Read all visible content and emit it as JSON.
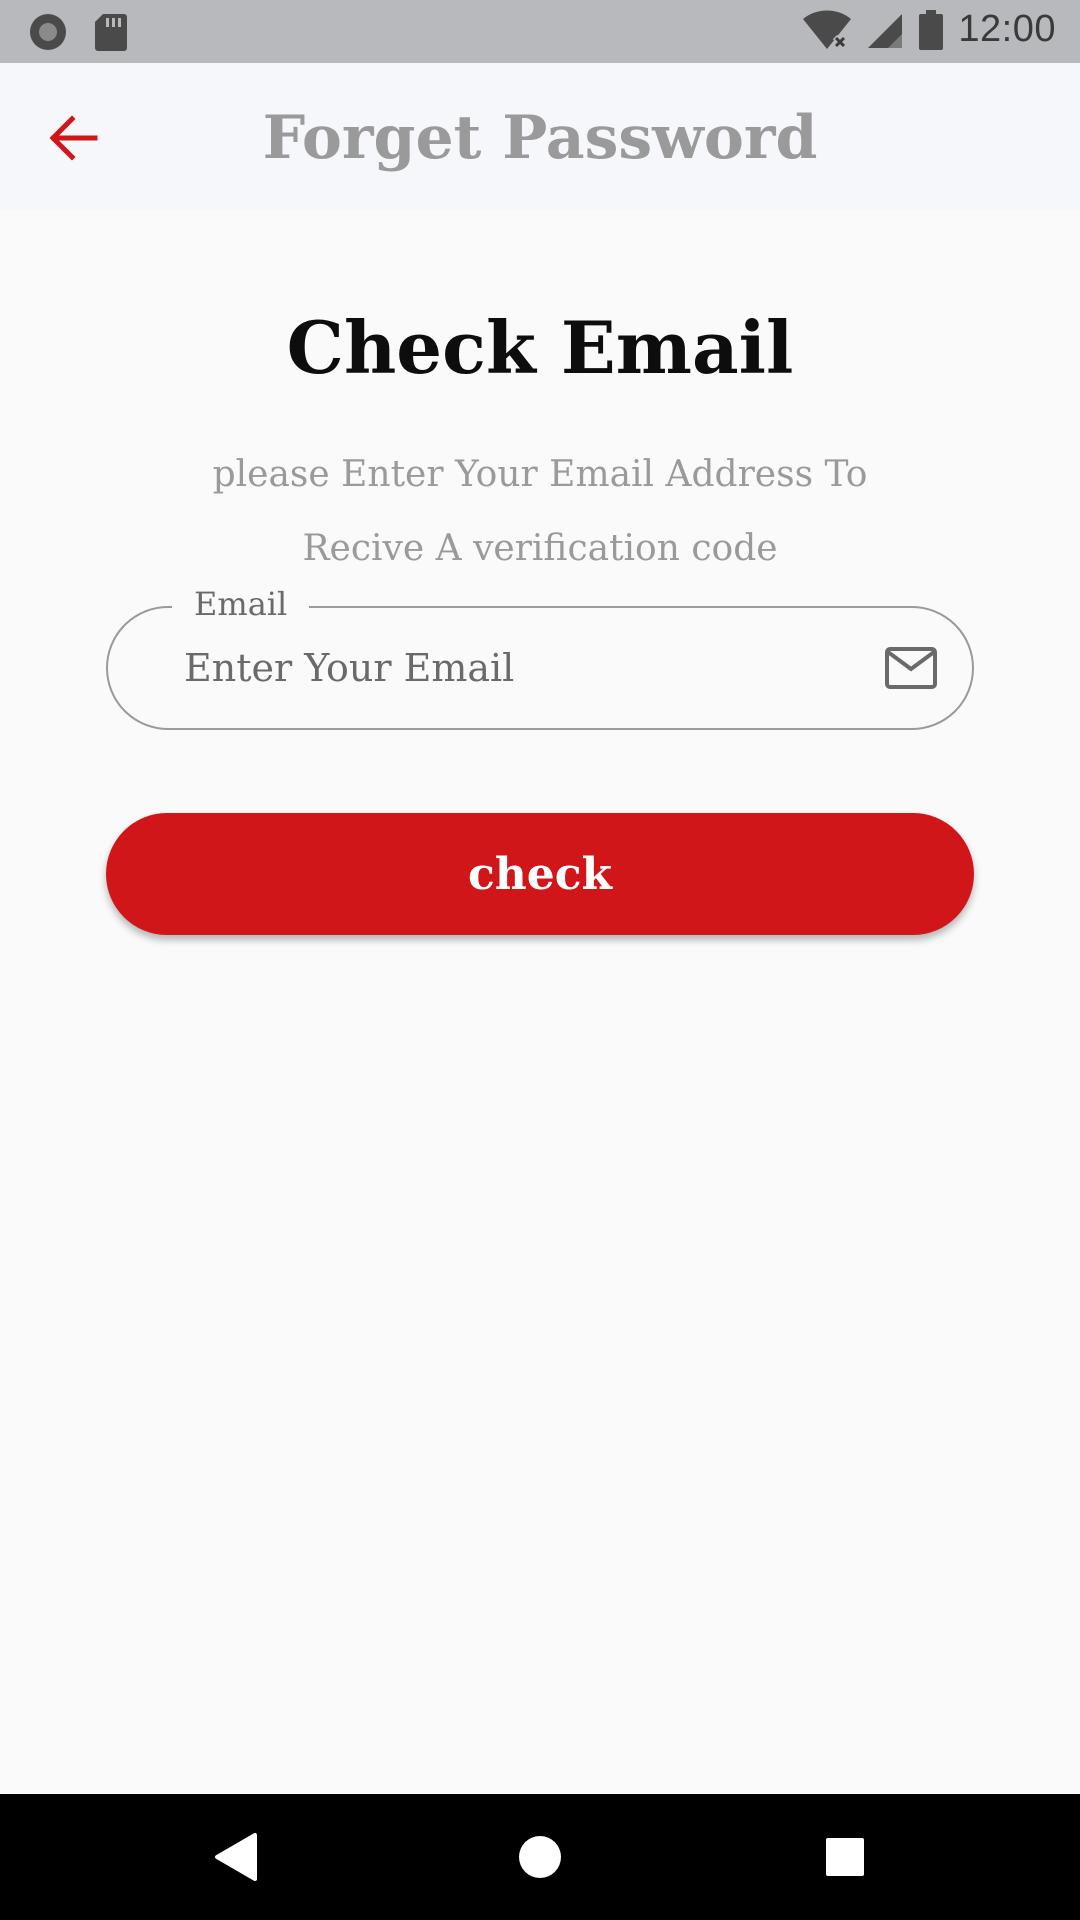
{
  "status_bar": {
    "time": "12:00",
    "icons": [
      "record-icon",
      "sd-card-icon",
      "wifi-off-icon",
      "cell-signal-icon",
      "battery-icon"
    ]
  },
  "app_bar": {
    "title": "Forget Password",
    "back_icon": "arrow-back-icon"
  },
  "main": {
    "title": "Check Email",
    "subtitle": "please Enter Your Email Address To Recive A verification code",
    "email_field": {
      "label": "Email",
      "placeholder": "Enter Your Email",
      "value": "",
      "icon": "mail-icon"
    },
    "check_button_label": "check"
  },
  "nav_bar": {
    "buttons": [
      "back-nav",
      "home-nav",
      "recents-nav"
    ]
  },
  "colors": {
    "accent": "#d01619",
    "title_gray": "#9a9a9a",
    "status_bar": "#b8b9bd",
    "app_bar": "#f6f7fb",
    "background": "#fafafa"
  }
}
